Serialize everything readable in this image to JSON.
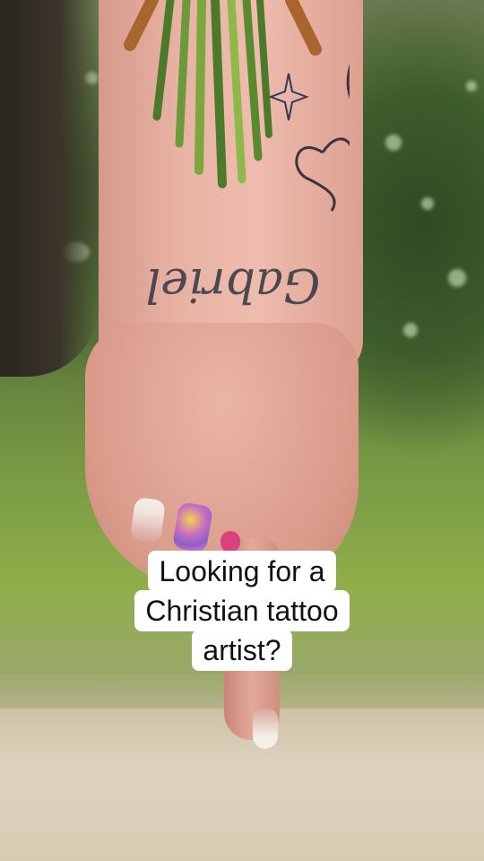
{
  "photo": {
    "subject": "wrist-tattoo-photo",
    "tattoo_script_text": "Gabriel",
    "colors": {
      "foliage_dark": "#2f4a24",
      "grass": "#8fae4a",
      "skin": "#e8b2a3",
      "path": "#d9cdb4"
    }
  },
  "caption": {
    "lines": [
      "Looking for a",
      "Christian tattoo",
      "artist?"
    ]
  }
}
